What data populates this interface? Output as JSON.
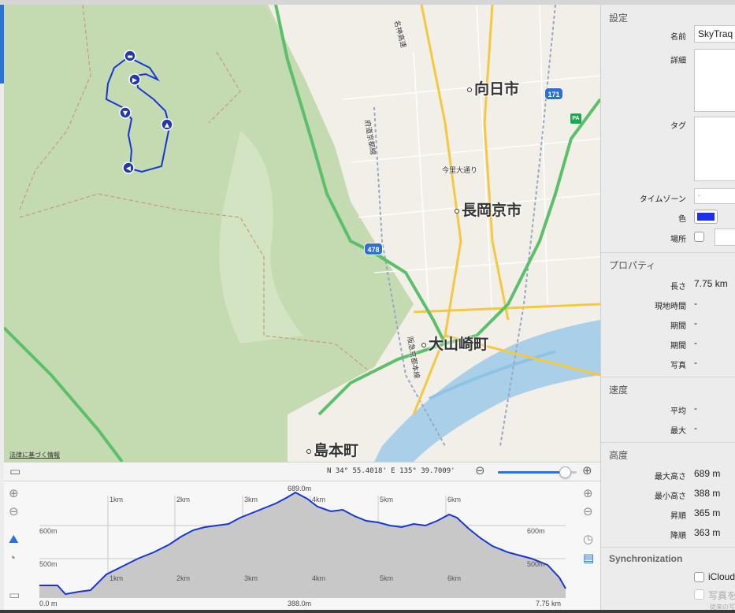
{
  "map": {
    "cities": [
      "向日市",
      "長岡京市",
      "大山崎町",
      "島本町"
    ],
    "roads": [
      "今里大通り",
      "府道京都線",
      "阪急京都本線",
      "名神高速"
    ],
    "route_shields": [
      "171",
      "478"
    ],
    "pa_label": "PA",
    "legal_link": "法律に基づく情報",
    "track_color": "#1736d6"
  },
  "map_toolbar": {
    "coordinate": "N 34° 55.4018' E 135° 39.7009'",
    "zoom_level": 0.85
  },
  "elevation": {
    "km_labels": [
      "1km",
      "2km",
      "3km",
      "4km",
      "5km",
      "6km"
    ],
    "alt_labels": [
      "600m",
      "500m"
    ],
    "max_label": "689.0m",
    "min_label": "388.0m",
    "start_label": "0.0 m",
    "end_label": "7.75 km"
  },
  "inspector": {
    "settings": {
      "title": "設定",
      "name_label": "名前",
      "name_value": "SkyTraq",
      "detail_label": "詳細",
      "tag_label": "タグ",
      "timezone_label": "タイムゾーン",
      "timezone_value": "-",
      "color_label": "色",
      "color_value": "#1a2ff0",
      "location_label": "場所"
    },
    "properties": {
      "title": "プロパティ",
      "length_label": "長さ",
      "length_value": "7.75 km",
      "local_time_label": "現地時間",
      "local_time_value": "-",
      "period1_label": "期間",
      "period1_value": "-",
      "period2_label": "期間",
      "period2_value": "-",
      "photo_label": "写真",
      "photo_value": "-"
    },
    "speed": {
      "title": "速度",
      "avg_label": "平均",
      "avg_value": "-",
      "max_label": "最大",
      "max_value": "-"
    },
    "altitude": {
      "title": "高度",
      "max_label": "最大高さ",
      "max_value": "689 m",
      "min_label": "最小高さ",
      "min_value": "388 m",
      "ascent_label": "昇順",
      "ascent_value": "365 m",
      "descent_label": "降順",
      "descent_value": "363 m"
    },
    "sync": {
      "title": "Synchronization",
      "icloud_label": "iCloud",
      "photo_label": "写真を",
      "footnote": "従来の写"
    }
  }
}
